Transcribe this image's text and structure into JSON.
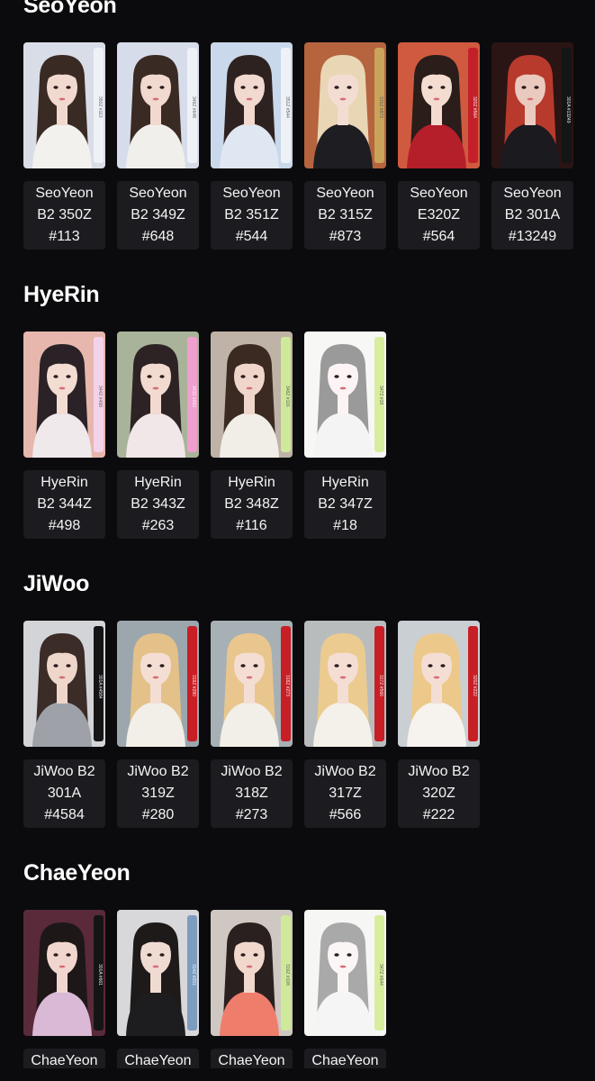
{
  "sections": [
    {
      "title": "SeoYeon",
      "cards": [
        {
          "lines": [
            "SeoYeon",
            "B2 350Z",
            "#113"
          ],
          "bg": "#d9dde8",
          "hair": "#3a2a24",
          "skin": "#f1d9cf",
          "outfit": "#f3f1ee",
          "bar": "#eef1f6",
          "side_text": "350Z #113"
        },
        {
          "lines": [
            "SeoYeon",
            "B2 349Z",
            "#648"
          ],
          "bg": "#d6dcea",
          "hair": "#3a2a24",
          "skin": "#f1d9cf",
          "outfit": "#f1efec",
          "bar": "#eef1f6",
          "side_text": "349Z #648"
        },
        {
          "lines": [
            "SeoYeon",
            "B2 351Z",
            "#544"
          ],
          "bg": "#c9d8ea",
          "hair": "#2e2220",
          "skin": "#f1d9cf",
          "outfit": "#dfe7f3",
          "bar": "#eef1f6",
          "side_text": "351Z #544"
        },
        {
          "lines": [
            "SeoYeon",
            "B2 315Z",
            "#873"
          ],
          "bg": "#b5643e",
          "hair": "#e9d6b5",
          "skin": "#f3ddd3",
          "outfit": "#1e1d22",
          "bar": "#c9a45a",
          "side_text": "315Z #873"
        },
        {
          "lines": [
            "SeoYeon",
            "E320Z",
            "#564"
          ],
          "bg": "#d05a3f",
          "hair": "#2a1d1a",
          "skin": "#f4dcd0",
          "outfit": "#b51f2a",
          "bar": "#c4202a",
          "side_text": "320Z #564"
        },
        {
          "lines": [
            "SeoYeon",
            "B2 301A",
            "#13249"
          ],
          "bg": "#2a1414",
          "hair": "#b83a2c",
          "skin": "#eacabf",
          "outfit": "#1a1a1f",
          "bar": "#151515",
          "side_text": "301A #13249"
        }
      ]
    },
    {
      "title": "HyeRin",
      "cards": [
        {
          "lines": [
            "HyeRin",
            "B2 344Z",
            "#498"
          ],
          "bg": "#e7b7ad",
          "hair": "#2a2226",
          "skin": "#f3dcd2",
          "outfit": "#efe9ec",
          "bar": "#f4d3ea",
          "side_text": "344Z #498"
        },
        {
          "lines": [
            "HyeRin",
            "B2 343Z",
            "#263"
          ],
          "bg": "#a9b39a",
          "hair": "#2d2325",
          "skin": "#f2dad0",
          "outfit": "#f1e6e8",
          "bar": "#ef9fcf",
          "side_text": "343Z #263"
        },
        {
          "lines": [
            "HyeRin",
            "B2 348Z",
            "#116"
          ],
          "bg": "#bfb2a6",
          "hair": "#3a2a22",
          "skin": "#f0d6ca",
          "outfit": "#f1ede7",
          "bar": "#cfe99a",
          "side_text": "348Z #116"
        },
        {
          "lines": [
            "HyeRin",
            "B2 347Z",
            "#18"
          ],
          "bg": "#f7f7f5",
          "hair": "#9a9a9a",
          "skin": "#fbf3f4",
          "outfit": "#f4f4f4",
          "bar": "#d8ee9e",
          "side_text": "347Z #18"
        }
      ]
    },
    {
      "title": "JiWoo",
      "cards": [
        {
          "lines": [
            "JiWoo B2",
            "301A",
            "#4584"
          ],
          "bg": "#d2d4d8",
          "hair": "#3b2c27",
          "skin": "#eed6cb",
          "outfit": "#9ea2a8",
          "bar": "#151515",
          "side_text": "301A #4584"
        },
        {
          "lines": [
            "JiWoo B2",
            "319Z",
            "#280"
          ],
          "bg": "#9ba7ad",
          "hair": "#e3c189",
          "skin": "#f4ded4",
          "outfit": "#f1efe8",
          "bar": "#c81e25",
          "side_text": "319Z #280"
        },
        {
          "lines": [
            "JiWoo B2",
            "318Z",
            "#273"
          ],
          "bg": "#a7b0b5",
          "hair": "#e9c68e",
          "skin": "#f4ded4",
          "outfit": "#f2efe8",
          "bar": "#c81e25",
          "side_text": "318Z #273"
        },
        {
          "lines": [
            "JiWoo B2",
            "317Z",
            "#566"
          ],
          "bg": "#b9bcbd",
          "hair": "#eccb90",
          "skin": "#f4ded4",
          "outfit": "#f4f1ea",
          "bar": "#c81e25",
          "side_text": "317Z #566"
        },
        {
          "lines": [
            "JiWoo B2",
            "320Z",
            "#222"
          ],
          "bg": "#c9cfd3",
          "hair": "#ecc88a",
          "skin": "#f4ded4",
          "outfit": "#f6f3ee",
          "bar": "#c81e25",
          "side_text": "320Z #222"
        }
      ]
    },
    {
      "title": "ChaeYeon",
      "cards": [
        {
          "lines": [
            "ChaeYeon"
          ],
          "bg": "#5a2a3a",
          "hair": "#1e1718",
          "skin": "#f1d6cf",
          "outfit": "#d9b9d6",
          "bar": "#151515",
          "side_text": "301A #661"
        },
        {
          "lines": [
            "ChaeYeon"
          ],
          "bg": "#d8d8da",
          "hair": "#1f1a1a",
          "skin": "#f0dbd3",
          "outfit": "#1d1d1f",
          "bar": "#7d9cc0",
          "side_text": "314Z #201"
        },
        {
          "lines": [
            "ChaeYeon"
          ],
          "bg": "#cfc8c2",
          "hair": "#2a201f",
          "skin": "#f0d8cd",
          "outfit": "#ef7d6c",
          "bar": "#cfe99a",
          "side_text": "319Z #108"
        },
        {
          "lines": [
            "ChaeYeon"
          ],
          "bg": "#f6f6f4",
          "hair": "#a9a9a9",
          "skin": "#fbf6f6",
          "outfit": "#f5f5f5",
          "bar": "#d8ee9e",
          "side_text": "347Z #644"
        }
      ]
    }
  ]
}
